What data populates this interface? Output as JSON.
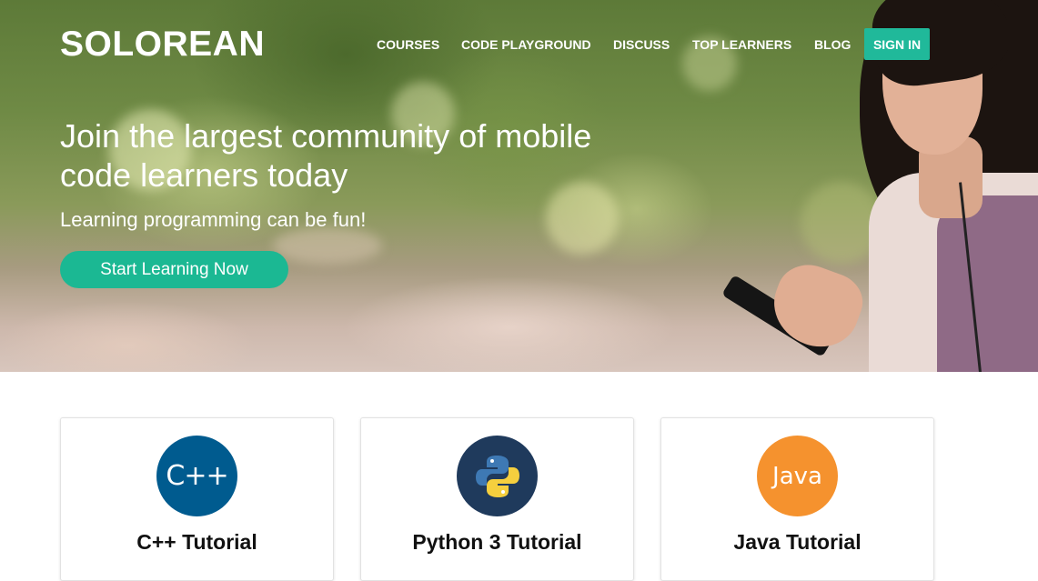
{
  "brand": {
    "logo": "SOLOREAN"
  },
  "nav": {
    "items": [
      "COURSES",
      "CODE PLAYGROUND",
      "DISCUSS",
      "TOP LEARNERS",
      "BLOG"
    ],
    "signin": "SIGN IN"
  },
  "hero": {
    "headline": "Join the largest community of mobile code learners today",
    "subline": "Learning programming can be fun!",
    "cta": "Start Learning Now"
  },
  "courses": [
    {
      "title": "C++ Tutorial",
      "icon_text": "C++",
      "icon": "cpp-logo-icon",
      "color": "#005b8f"
    },
    {
      "title": "Python 3 Tutorial",
      "icon": "python-logo-icon",
      "color": "#1f3a5c"
    },
    {
      "title": "Java Tutorial",
      "icon_text": "Java",
      "icon": "java-logo-icon",
      "color": "#f5922e"
    }
  ],
  "colors": {
    "accent": "#20b99a"
  }
}
